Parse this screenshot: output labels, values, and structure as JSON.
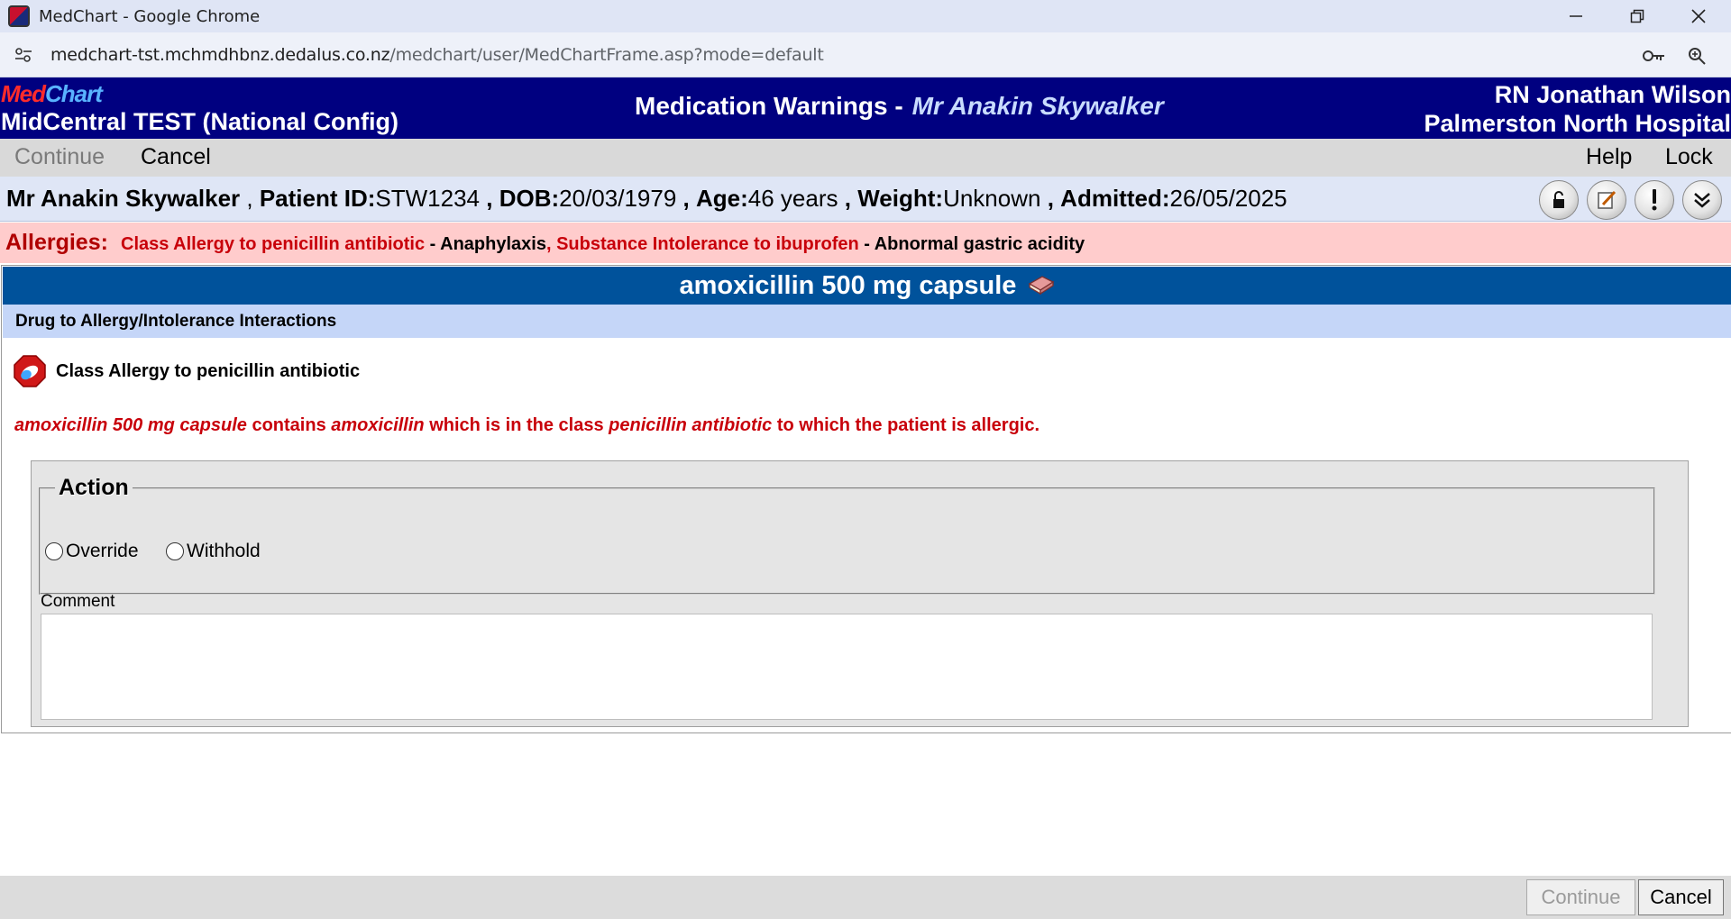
{
  "browser": {
    "window_title": "MedChart - Google Chrome",
    "url_host": "medchart-tst.mchmdhbnz.dedalus.co.nz",
    "url_path": "/medchart/user/MedChartFrame.asp?mode=default"
  },
  "header": {
    "logo_med": "Med",
    "logo_chart": "Chart",
    "org": "MidCentral TEST (National Config)",
    "screen_title": "Medication Warnings -",
    "patient_name": "Mr Anakin Skywalker",
    "user": "RN Jonathan Wilson",
    "hospital": "Palmerston North Hospital"
  },
  "menu": {
    "continue": "Continue",
    "cancel": "Cancel",
    "help": "Help",
    "lock": "Lock"
  },
  "patient": {
    "name": "Mr Anakin Skywalker",
    "id_label": "Patient ID:",
    "id": "STW1234",
    "dob_label": "DOB:",
    "dob": "20/03/1979",
    "age_label": "Age:",
    "age": "46 years",
    "weight_label": "Weight:",
    "weight": "Unknown",
    "admitted_label": "Admitted:",
    "admitted": "26/05/2025"
  },
  "allergies": {
    "label": "Allergies:",
    "items": [
      {
        "name": "Class Allergy to penicillin antibiotic",
        "reaction": "Anaphylaxis"
      },
      {
        "name": "Substance Intolerance to ibuprofen",
        "reaction": "Abnormal gastric acidity"
      }
    ]
  },
  "drug": {
    "title": "amoxicillin 500 mg capsule"
  },
  "section": {
    "title": "Drug to Allergy/Intolerance Interactions",
    "interaction_label": "Class Allergy to penicillin antibiotic",
    "warning": {
      "drug": "amoxicillin 500 mg capsule",
      "t1": "contains",
      "ingredient": "amoxicillin",
      "t2": "which is in the class",
      "class": "penicillin antibiotic",
      "t3": "to which the patient is allergic."
    }
  },
  "action": {
    "legend": "Action",
    "override": "Override",
    "withhold": "Withhold",
    "comment_label": "Comment",
    "comment_value": ""
  },
  "footer": {
    "continue": "Continue",
    "cancel": "Cancel"
  },
  "icons": {
    "app": "medchart-app-icon",
    "site_info": "tune-icon",
    "password": "key-icon",
    "zoom": "zoom-icon",
    "drug_info": "book-icon",
    "interaction": "stop-sign-icon"
  },
  "colors": {
    "header_bg": "#000080",
    "drug_bar_bg": "#00529b",
    "allergy_bg": "#ffcccc",
    "warning_text": "#c8000a"
  }
}
